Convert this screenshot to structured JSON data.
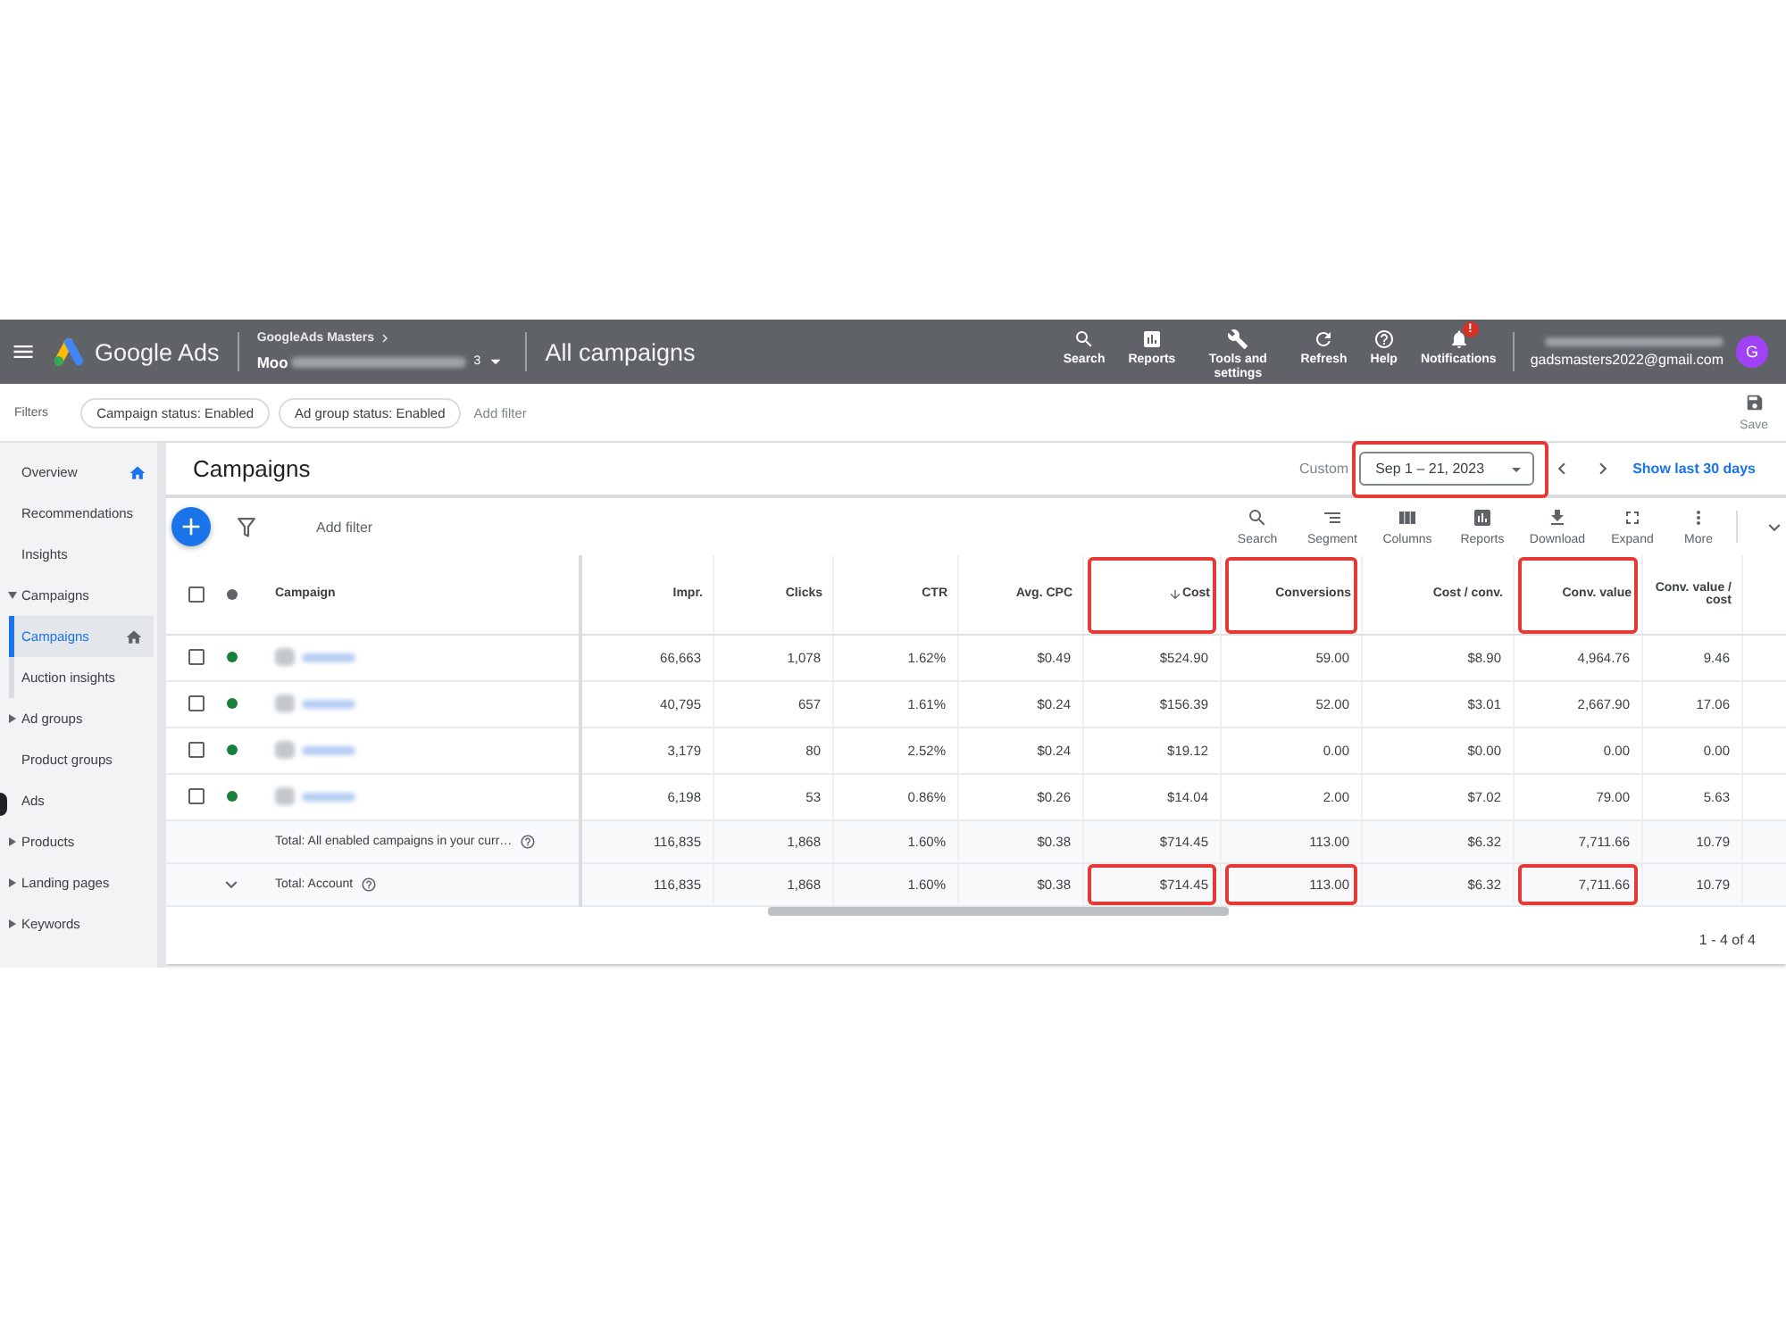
{
  "header": {
    "app_name": "Google Ads",
    "manager": "GoogleAds Masters",
    "account_start": "Moo",
    "account_end": "3",
    "page_title": "All campaigns",
    "actions": [
      {
        "kind": "search",
        "label": "Search"
      },
      {
        "kind": "reports",
        "label": "Reports"
      },
      {
        "kind": "tools",
        "label": "Tools and settings"
      },
      {
        "kind": "refresh",
        "label": "Refresh"
      },
      {
        "kind": "help",
        "label": "Help"
      },
      {
        "kind": "notifications",
        "label": "Notifications",
        "badge": "!"
      }
    ],
    "email": "gadsmasters2022@gmail.com",
    "avatar": "G"
  },
  "filters": {
    "label": "Filters",
    "chips": [
      "Campaign status: Enabled",
      "Ad group status: Enabled"
    ],
    "add_filter": "Add filter",
    "save": "Save"
  },
  "sidebar": {
    "items": [
      {
        "label": "Overview",
        "selected": false,
        "home": true
      },
      {
        "label": "Recommendations",
        "selected": false
      },
      {
        "label": "Insights",
        "selected": false
      },
      {
        "label": "Campaigns",
        "selected": false,
        "expanded": true,
        "children": [
          {
            "label": "Campaigns",
            "selected": true,
            "home": true
          },
          {
            "label": "Auction insights",
            "selected": false
          }
        ]
      },
      {
        "label": "Ad groups",
        "selected": false,
        "expanded": false
      },
      {
        "label": "Product groups",
        "selected": false
      },
      {
        "label": "Ads",
        "selected": false
      },
      {
        "label": "Products",
        "selected": false,
        "expanded": false
      },
      {
        "label": "Landing pages",
        "selected": false,
        "expanded": false
      },
      {
        "label": "Keywords",
        "selected": false,
        "expanded": false
      }
    ]
  },
  "panel": {
    "title": "Campaigns",
    "date_preset": "Custom",
    "date_range": {
      "value": "Sep 1 – 21, 2023",
      "highlighted": true
    },
    "show_last": "Show last 30 days",
    "add_filter": "Add filter",
    "tools": [
      {
        "kind": "search",
        "label": "Search"
      },
      {
        "kind": "segment",
        "label": "Segment"
      },
      {
        "kind": "columns",
        "label": "Columns"
      },
      {
        "kind": "reports",
        "label": "Reports"
      },
      {
        "kind": "download",
        "label": "Download"
      },
      {
        "kind": "expand",
        "label": "Expand"
      },
      {
        "kind": "more",
        "label": "More"
      }
    ]
  },
  "table": {
    "select_all": {
      "checked": false
    },
    "name_column": "Campaign",
    "columns": [
      {
        "label": "Impr.",
        "sorted": false,
        "highlighted": false
      },
      {
        "label": "Clicks",
        "sorted": false,
        "highlighted": false
      },
      {
        "label": "CTR",
        "sorted": false,
        "highlighted": false
      },
      {
        "label": "Avg. CPC",
        "sorted": false,
        "highlighted": false
      },
      {
        "label": "Cost",
        "sorted": true,
        "highlighted": true
      },
      {
        "label": "Conversions",
        "sorted": false,
        "highlighted": true
      },
      {
        "label": "Cost / conv.",
        "sorted": false,
        "highlighted": false
      },
      {
        "label": "Conv. value",
        "sorted": false,
        "highlighted": true
      },
      {
        "label": "Conv. value / cost",
        "sorted": false,
        "highlighted": false
      }
    ],
    "rows": [
      {
        "checked": false,
        "color": "#188038",
        "cells": [
          "66,663",
          "1,078",
          "1.62%",
          "$0.49",
          "$524.90",
          "59.00",
          "$8.90",
          "4,964.76",
          "9.46"
        ]
      },
      {
        "checked": false,
        "color": "#188038",
        "cells": [
          "40,795",
          "657",
          "1.61%",
          "$0.24",
          "$156.39",
          "52.00",
          "$3.01",
          "2,667.90",
          "17.06"
        ]
      },
      {
        "checked": false,
        "color": "#188038",
        "cells": [
          "3,179",
          "80",
          "2.52%",
          "$0.24",
          "$19.12",
          "0.00",
          "$0.00",
          "0.00",
          "0.00"
        ]
      },
      {
        "checked": false,
        "color": "#188038",
        "cells": [
          "6,198",
          "53",
          "0.86%",
          "$0.26",
          "$14.04",
          "2.00",
          "$7.02",
          "79.00",
          "5.63"
        ]
      }
    ],
    "totals": [
      {
        "label": "Total: All enabled campaigns in your curr…",
        "highlighted": false,
        "cells": [
          "116,835",
          "1,868",
          "1.60%",
          "$0.38",
          "$714.45",
          "113.00",
          "$6.32",
          "7,711.66",
          "10.79"
        ]
      },
      {
        "label": "Total: Account",
        "expanded": false,
        "highlighted": true,
        "cells": [
          "116,835",
          "1,868",
          "1.60%",
          "$0.38",
          "$714.45",
          "113.00",
          "$6.32",
          "7,711.66",
          "10.79"
        ]
      }
    ]
  },
  "pagination": "1 - 4 of 4"
}
